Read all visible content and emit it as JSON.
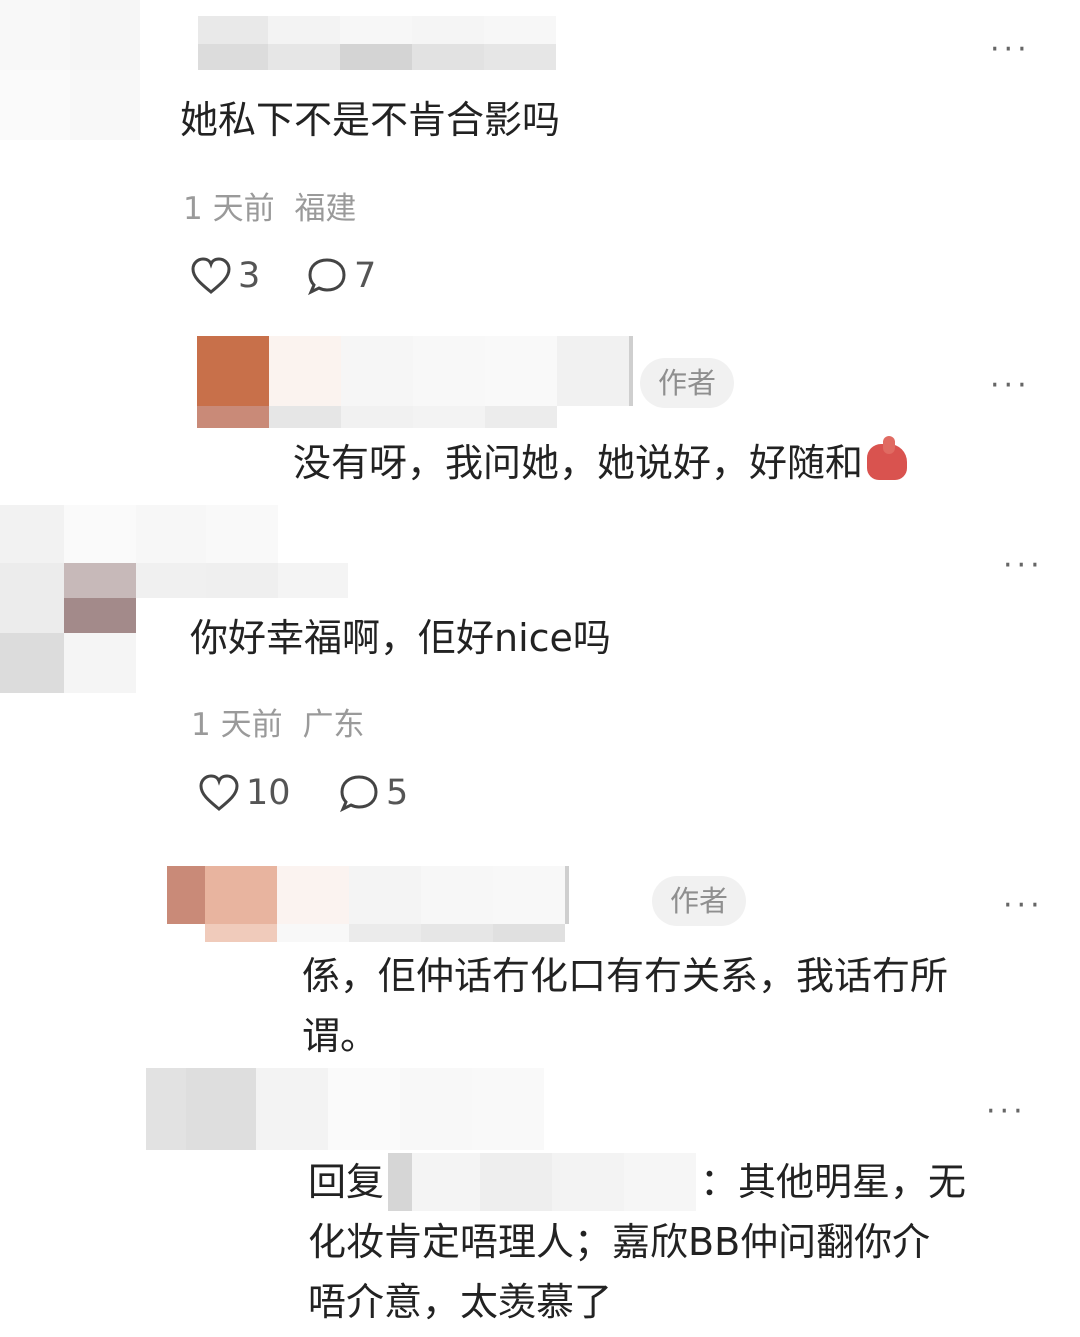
{
  "comments": [
    {
      "text": "她私下不是不肯合影吗",
      "meta_time": "1 天前",
      "meta_location": "福建",
      "likes": "3",
      "replies": "7",
      "more": "···",
      "reply": {
        "badge": "作者",
        "text": "没有呀，我问她，她说好，好随和",
        "emoji": "fist-emoji",
        "more": "···"
      }
    },
    {
      "text": "你好幸福啊，佢好nice吗",
      "meta_time": "1 天前",
      "meta_location": "广东",
      "likes": "10",
      "replies": "5",
      "more": "···",
      "reply": {
        "badge": "作者",
        "text_line1": "係，佢仲话冇化口有冇关系，我话冇所",
        "text_line2": "谓。",
        "more": "···"
      },
      "reply2": {
        "prefix": "回复",
        "suffix_line1": "：其他明星，无",
        "text_line2": "化妆肯定唔理人；嘉欣BB仲问翻你介",
        "text_line3": "唔介意，太羡慕了",
        "more": "···"
      }
    }
  ],
  "icons": {
    "like": "heart-icon",
    "comment": "comment-bubble-icon"
  }
}
